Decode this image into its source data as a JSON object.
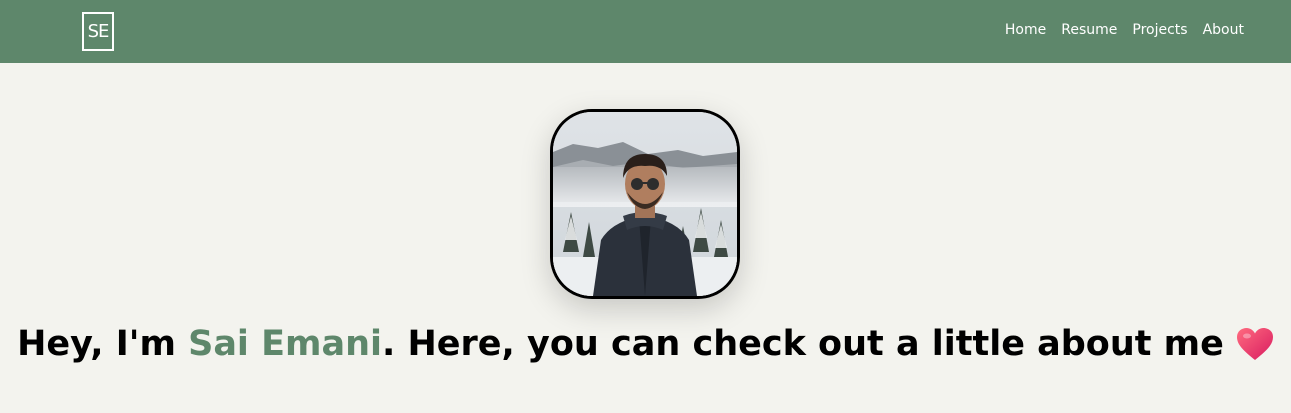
{
  "header": {
    "logo_text": "SE",
    "nav": [
      {
        "label": "Home"
      },
      {
        "label": "Resume"
      },
      {
        "label": "Projects"
      },
      {
        "label": "About"
      }
    ]
  },
  "hero": {
    "avatar_icon": "profile-photo",
    "greeting_prefix": "Hey, I'm ",
    "name": "Sai Emani",
    "greeting_suffix": ". Here, you can check out a little about me",
    "emoji_icon": "heart-icon"
  },
  "colors": {
    "nav_background": "#5e876b",
    "page_background": "#f3f3ee",
    "accent": "#5e876b",
    "heart": "#f0365f"
  }
}
